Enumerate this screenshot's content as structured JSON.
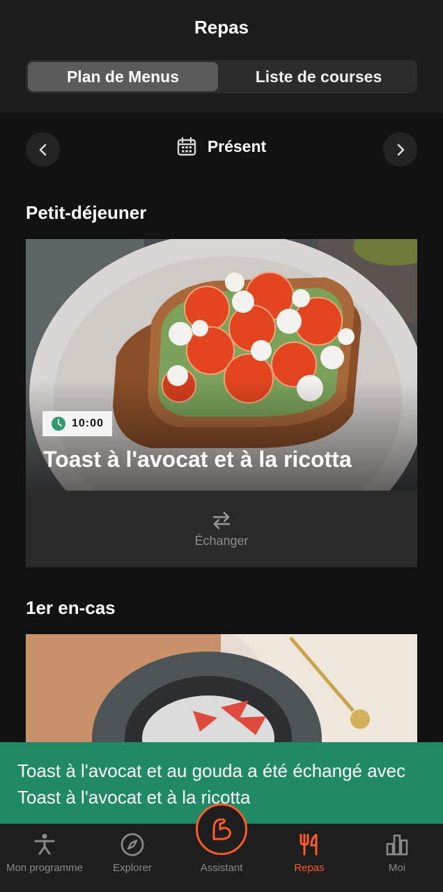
{
  "header": {
    "title": "Repas",
    "tabs": [
      {
        "label": "Plan de Menus",
        "active": true
      },
      {
        "label": "Liste de courses",
        "active": false
      }
    ]
  },
  "date_nav": {
    "label": "Présent",
    "prev_icon": "chevron-left-icon",
    "next_icon": "chevron-right-icon",
    "calendar_icon": "calendar-icon"
  },
  "meals": [
    {
      "section": "Petit-déjeuner",
      "time": "10:00",
      "name": "Toast à l'avocat et à la ricotta",
      "swap_label": "Échanger"
    },
    {
      "section": "1er en-cas"
    }
  ],
  "toast": {
    "message": "Toast à l'avocat et au gouda a été échangé avec Toast à l'avocat et à la ricotta"
  },
  "bottom_nav": {
    "items": [
      {
        "label": "Mon programme",
        "icon": "exercise-icon"
      },
      {
        "label": "Explorer",
        "icon": "compass-icon"
      },
      {
        "label": "Assistant",
        "icon": "muscle-arm-icon"
      },
      {
        "label": "Repas",
        "icon": "fork-knife-icon",
        "active": true
      },
      {
        "label": "Moi",
        "icon": "bar-chart-icon"
      }
    ]
  },
  "colors": {
    "accent": "#ff5a2a",
    "toast": "#1f8a63",
    "clock": "#2e9b6a",
    "background": "#121212"
  }
}
